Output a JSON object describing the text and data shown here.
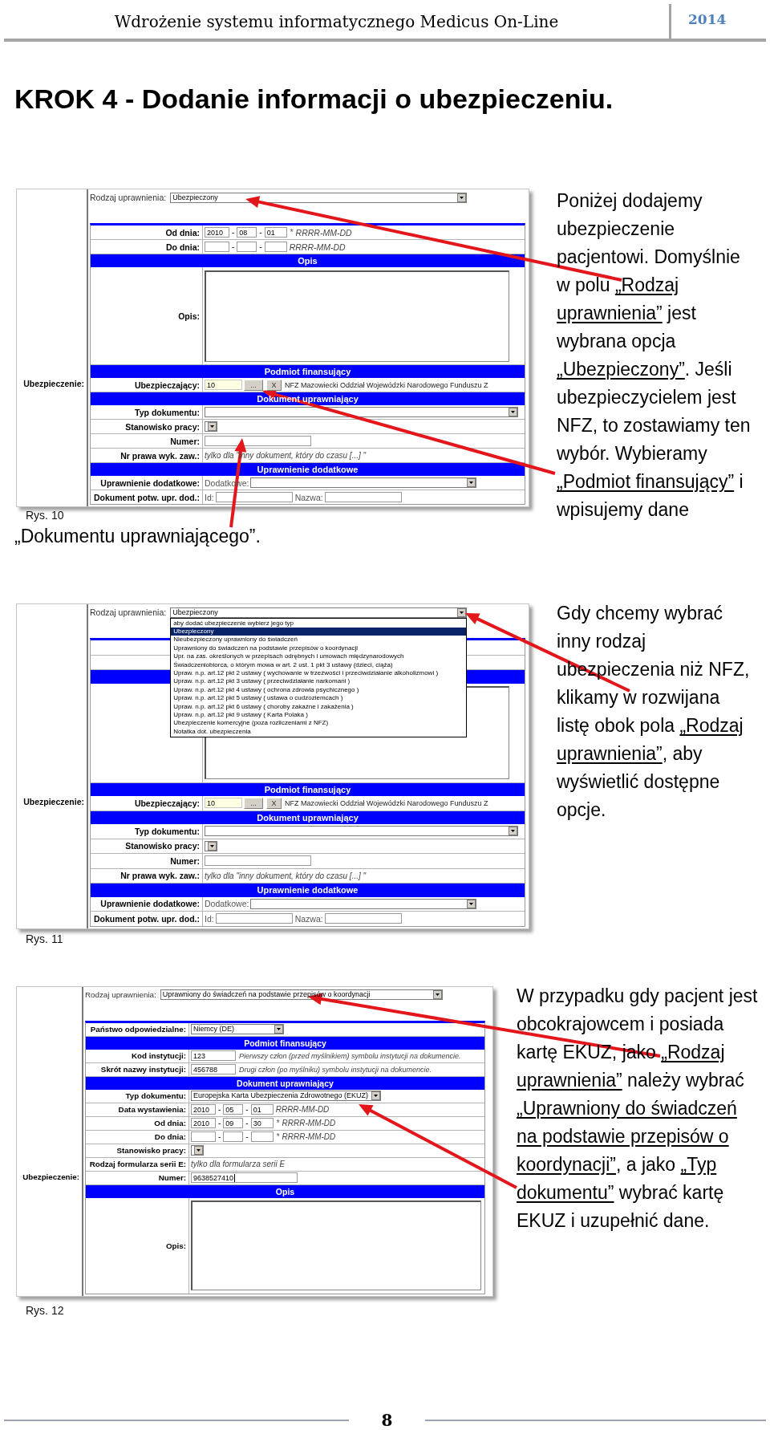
{
  "header": {
    "title": "Wdrożenie systemu informatycznego Medicus On-Line",
    "year": "2014"
  },
  "heading": "KROK 4 - Dodanie informacji o ubezpieczeniu.",
  "sections": [
    {
      "figure": {
        "side_label": "Ubezpieczenie:",
        "rodzaj_label": "Rodzaj uprawnienia:",
        "rodzaj_value": "Ubezpieczony",
        "rows": [
          {
            "kind": "date",
            "label": "Od dnia:",
            "year": "2010",
            "month": "08",
            "day": "01",
            "separators": [
              "-",
              "-"
            ],
            "star": "*",
            "hint": "RRRR-MM-DD"
          },
          {
            "kind": "date",
            "label": "Do dnia:",
            "separators": [
              "-",
              "-"
            ],
            "hint": "RRRR-MM-DD"
          },
          {
            "kind": "section",
            "title": "Opis"
          },
          {
            "kind": "textarea",
            "label": "Opis:"
          },
          {
            "kind": "section",
            "title": "Podmiot finansujący"
          },
          {
            "kind": "lookup",
            "label": "Ubezpieczający:",
            "value": "10",
            "button": "...",
            "clear": "X",
            "name": "NFZ Mazowiecki Oddział Wojewódzki Narodowego Funduszu Z"
          },
          {
            "kind": "section",
            "title": "Dokument uprawniający"
          },
          {
            "kind": "select",
            "label": "Typ dokumentu:"
          },
          {
            "kind": "combo",
            "label": "Stanowisko pracy:"
          },
          {
            "kind": "text",
            "label": "Numer:"
          },
          {
            "kind": "note",
            "label": "Nr prawa wyk. zaw.:",
            "note": "tylko dla \"inny dokument, który do czasu [...] \""
          },
          {
            "kind": "section",
            "title": "Uprawnienie dodatkowe"
          },
          {
            "kind": "extra",
            "label": "Uprawnienie dodatkowe:",
            "prefix": "Dodatkowe:"
          },
          {
            "kind": "pair",
            "label": "Dokument potw. upr. dod.:",
            "first": "Id:",
            "second": "Nazwa:"
          }
        ]
      },
      "caption": "Rys. 10",
      "text": [
        {
          "text": "Poniżej dodajemy ubezpieczenie pacjentowi. Domyślnie w polu ",
          "underlined": false
        },
        {
          "text": "„Rodzaj uprawnienia”",
          "underlined": true
        },
        {
          "text": " jest wybrana opcja ",
          "underlined": false
        },
        {
          "text": "„Ubezpieczony”",
          "underlined": true
        },
        {
          "text": ". Jeśli ubezpieczycielem jest NFZ, to zostawiamy ten wybór. Wybieramy ",
          "underlined": false
        },
        {
          "text": "„Podmiot finansujący”",
          "underlined": true
        },
        {
          "text": " i wpisujemy dane",
          "underlined": false
        }
      ],
      "continuation": [
        {
          "text": "„Dokumentu uprawniającego”.",
          "underlined": false
        }
      ]
    },
    {
      "figure": {
        "side_label": "Ubezpieczenie:",
        "rodzaj_label": "Rodzaj uprawnienia:",
        "rodzaj_value": "Ubezpieczony",
        "dropdown": [
          {
            "text": "aby dodać ubezpieczenie wybierz jego typ",
            "selected": false
          },
          {
            "text": "Ubezpieczony",
            "selected": true
          },
          {
            "text": "Nieubezpieczony uprawniony do świadczeń",
            "selected": false
          },
          {
            "text": "Uprawniony do świadczeń na podstawie przepisów o koordynacji",
            "selected": false
          },
          {
            "text": "Upr. na zas. określonych w przepisach odrębnych i umowach międzynarodowych",
            "selected": false
          },
          {
            "text": "Świadczeniobiorca, o którym mowa w art. 2 ust. 1 pkt 3 ustawy (dzieci, ciąża)",
            "selected": false
          },
          {
            "text": "Upraw. n.p. art.12 pkt 2 ustawy ( wychowanie w trzeźwości i przeciwdziałanie alkoholizmowi )",
            "selected": false
          },
          {
            "text": "Upraw. n.p. art.12 pkt 3 ustawy ( przeciwdziałanie narkomani )",
            "selected": false
          },
          {
            "text": "Upraw. n.p. art.12 pkt 4 ustawy ( ochrona zdrowia psychicznego )",
            "selected": false
          },
          {
            "text": "Upraw. n.p. art.12 pkt 5 ustawy ( ustawa o cudzoziemcach )",
            "selected": false
          },
          {
            "text": "Upraw. n.p. art.12 pkt 6 ustawy ( choroby zakaźne i zakażenia )",
            "selected": false
          },
          {
            "text": "Upraw. n.p. art.12 pkt 9 ustawy ( Karta Polaka )",
            "selected": false
          },
          {
            "text": "Ubezpieczenie komercyjne (poza rozliczeniami z NFZ)",
            "selected": false
          },
          {
            "text": "Notatka dot. ubezpieczenia",
            "selected": false
          }
        ],
        "rows": [
          {
            "kind": "blank"
          },
          {
            "kind": "blank"
          },
          {
            "kind": "section"
          },
          {
            "kind": "textarea"
          },
          {
            "kind": "section",
            "title": "Podmiot finansujący"
          },
          {
            "kind": "lookup",
            "label": "Ubezpieczający:",
            "value": "10",
            "button": "...",
            "clear": "X",
            "name": "NFZ Mazowiecki Oddział Wojewódzki Narodowego Funduszu Z"
          },
          {
            "kind": "section",
            "title": "Dokument uprawniający"
          },
          {
            "kind": "select",
            "label": "Typ dokumentu:"
          },
          {
            "kind": "combo",
            "label": "Stanowisko pracy:"
          },
          {
            "kind": "text",
            "label": "Numer:"
          },
          {
            "kind": "note",
            "label": "Nr prawa wyk. zaw.:",
            "note": "tylko dla \"inny dokument, który do czasu [...] \""
          },
          {
            "kind": "section",
            "title": "Uprawnienie dodatkowe"
          },
          {
            "kind": "extra",
            "label": "Uprawnienie dodatkowe:",
            "prefix": "Dodatkowe:"
          },
          {
            "kind": "pair",
            "label": "Dokument potw. upr. dod.:",
            "first": "Id:",
            "second": "Nazwa:"
          }
        ]
      },
      "caption": "Rys. 11",
      "text": [
        {
          "text": "Gdy chcemy wybrać inny rodzaj ubezpieczenia niż NFZ, klikamy w rozwijana listę obok pola ",
          "underlined": false
        },
        {
          "text": "„Rodzaj uprawnienia”",
          "underlined": true
        },
        {
          "text": ", aby wyświetlić dostępne opcje.",
          "underlined": false
        }
      ]
    },
    {
      "figure": {
        "side_label": "Ubezpieczenie:",
        "rodzaj_label": "Rodzaj uprawnienia:",
        "rodzaj_value": "Uprawniony do świadczeń na podstawie przepisów o koordynacji",
        "rows": [
          {
            "kind": "select",
            "label": "Państwo odpowiedzialne:",
            "value": "Niemcy (DE)"
          },
          {
            "kind": "section",
            "title": "Podmiot finansujący"
          },
          {
            "kind": "text",
            "label": "Kod instytucji:",
            "value": "123",
            "hint": "Pierwszy człon (przed myślnikiem) symbolu instytucji na dokumencie."
          },
          {
            "kind": "text",
            "label": "Skrót nazwy instytucji:",
            "value": "456788",
            "hint": "Drugi człon (po myślniku) symbolu instytucji na dokumencie."
          },
          {
            "kind": "section",
            "title": "Dokument uprawniający"
          },
          {
            "kind": "select",
            "label": "Typ dokumentu:",
            "value": "Europejska Karta Ubezpieczenia Zdrowotnego (EKUZ)"
          },
          {
            "kind": "date",
            "label": "Data wystawienia:",
            "year": "2010",
            "month": "05",
            "day": "01",
            "separators": [
              "-",
              "-"
            ],
            "hint": "RRRR-MM-DD"
          },
          {
            "kind": "date",
            "label": "Od dnia:",
            "year": "2010",
            "month": "09",
            "day": "30",
            "separators": [
              "-",
              "-"
            ],
            "star": "*",
            "hint": "RRRR-MM-DD"
          },
          {
            "kind": "date",
            "label": "Do dnia:",
            "separators": [
              "-",
              "-"
            ],
            "star": "*",
            "hint": "RRRR-MM-DD"
          },
          {
            "kind": "combo",
            "label": "Stanowisko pracy:"
          },
          {
            "kind": "note",
            "label": "Rodzaj formularza serii E:",
            "note": "tylko dla formularza serii E"
          },
          {
            "kind": "text",
            "label": "Numer:",
            "value": "9638527410",
            "focused": true
          },
          {
            "kind": "section",
            "title": "Opis"
          },
          {
            "kind": "textarea",
            "label": "Opis:"
          }
        ]
      },
      "caption": "Rys. 12",
      "text": [
        {
          "text": "W przypadku gdy pacjent jest obcokrajowcem i posiada kartę EKUZ, jako ",
          "underlined": false
        },
        {
          "text": "„Rodzaj uprawnienia”",
          "underlined": true
        },
        {
          "text": " należy wybrać ",
          "underlined": false
        },
        {
          "text": "„Uprawniony do świadczeń na podstawie przepisów o koordynacji”",
          "underlined": true
        },
        {
          "text": ", a jako ",
          "underlined": false
        },
        {
          "text": "„Typ dokumentu”",
          "underlined": true
        },
        {
          "text": " wybrać kartę EKUZ i uzupełnić dane.",
          "underlined": false
        }
      ]
    }
  ],
  "footer": {
    "page_number": "8"
  }
}
